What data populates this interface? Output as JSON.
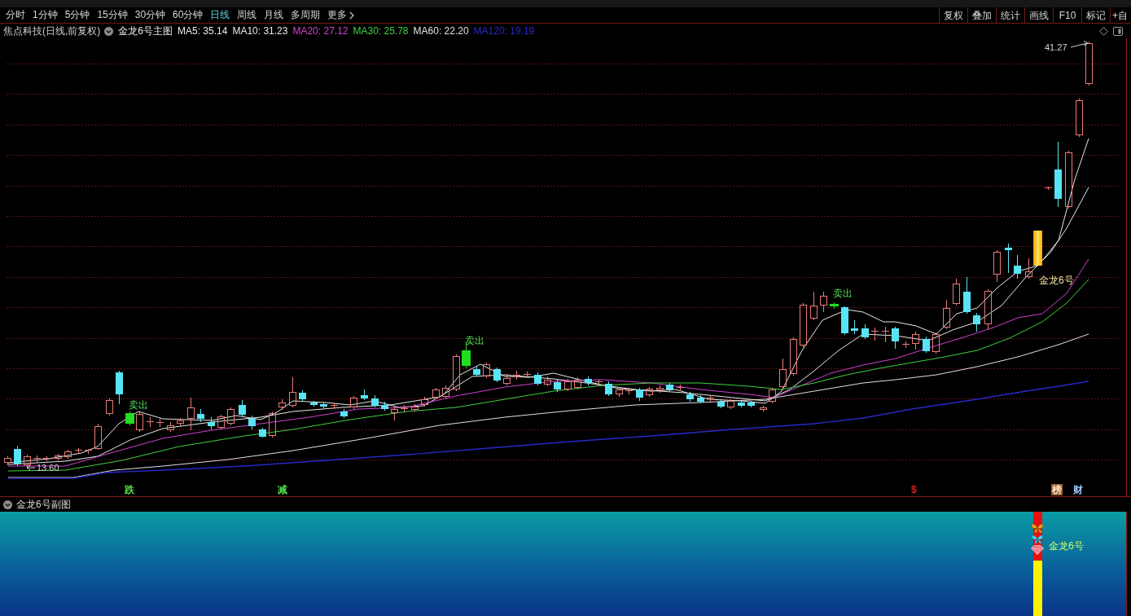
{
  "toolbar": {
    "tabs": [
      {
        "label": "分时",
        "kind": "tab",
        "selected": false
      },
      {
        "label": "1分钟",
        "kind": "tab",
        "selected": false
      },
      {
        "label": "5分钟",
        "kind": "tab",
        "selected": false
      },
      {
        "label": "15分钟",
        "kind": "tab",
        "selected": false
      },
      {
        "label": "30分钟",
        "kind": "tab",
        "selected": false
      },
      {
        "label": "60分钟",
        "kind": "tab",
        "selected": false
      },
      {
        "label": "日线",
        "kind": "tab",
        "selected": true
      },
      {
        "label": "周线",
        "kind": "tab",
        "selected": false
      },
      {
        "label": "月线",
        "kind": "tab",
        "selected": false
      },
      {
        "label": "多周期",
        "kind": "tab",
        "selected": false
      },
      {
        "label": "更多",
        "kind": "menu",
        "selected": false
      }
    ],
    "buttons": [
      "复权",
      "叠加",
      "统计",
      "画线",
      "F10",
      "标记",
      "+自"
    ]
  },
  "main_chart": {
    "title": "焦点科技(日线,前复权)",
    "indicator": "金龙6号主图",
    "legend": [
      {
        "label": "MA5: 35.14",
        "color": "#e8e8e8"
      },
      {
        "label": "MA10: 31.23",
        "color": "#e8e8e8"
      },
      {
        "label": "MA20: 27.12",
        "color": "#d040d0"
      },
      {
        "label": "MA30: 25.78",
        "color": "#40d040"
      },
      {
        "label": "MA60: 22.20",
        "color": "#e0e0e0"
      },
      {
        "label": "MA120: 19.19",
        "color": "#2828c8"
      }
    ],
    "high_label": "41.27",
    "low_label": "13.60",
    "signals": [
      "卖出",
      "卖出",
      "卖出"
    ],
    "line_label": "金龙6号",
    "marks": [
      {
        "text": "跌",
        "kind": "text",
        "color": "#50e050"
      },
      {
        "text": "减",
        "kind": "text",
        "color": "#50e050"
      },
      {
        "text": "$",
        "kind": "text",
        "color": "#e02020"
      },
      {
        "text": "榜",
        "kind": "badge",
        "color": "#9a5a2a"
      },
      {
        "text": "财",
        "kind": "text",
        "color": "#a0c8ff"
      }
    ]
  },
  "sub_chart": {
    "title": "金龙6号副图",
    "label": "金龙6号"
  }
}
